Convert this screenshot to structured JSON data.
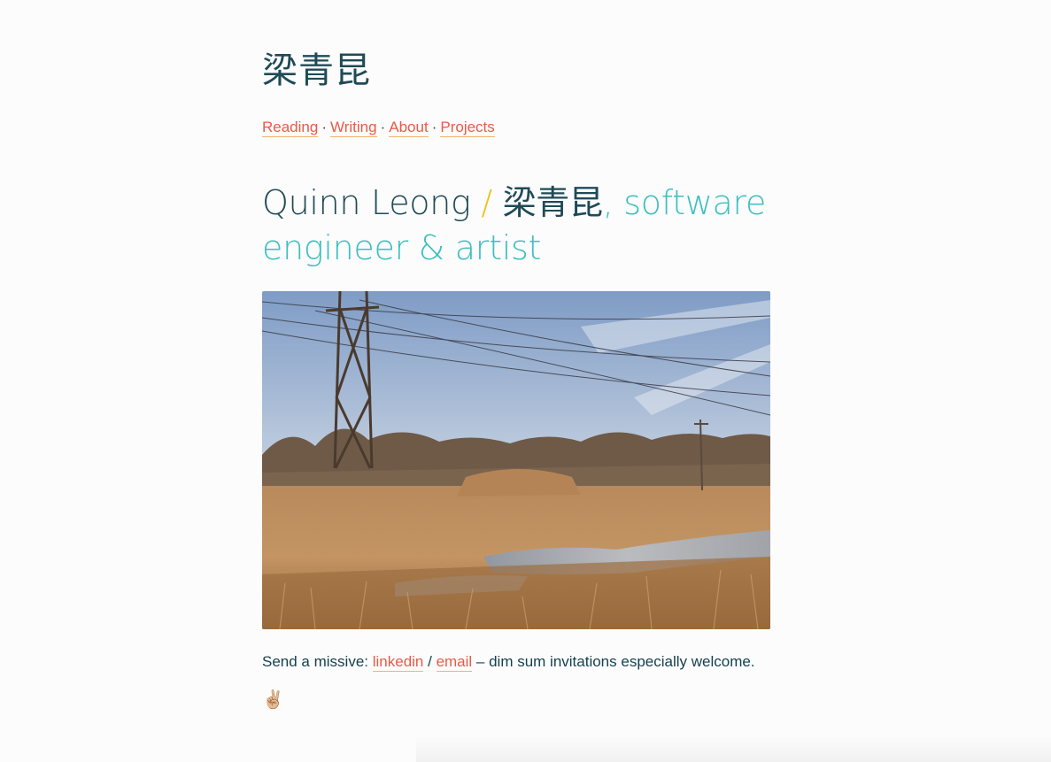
{
  "site": {
    "title": "梁青昆"
  },
  "nav": {
    "items": [
      {
        "label": "Reading"
      },
      {
        "label": "Writing"
      },
      {
        "label": "About"
      },
      {
        "label": "Projects"
      }
    ],
    "separator": "·"
  },
  "hero": {
    "name_en": "Quinn Leong",
    "slash": "/",
    "name_zh": "梁青昆",
    "tagline": ", software engineer & artist"
  },
  "photo": {
    "alt": "Power lines over a dry marsh field"
  },
  "contact": {
    "prefix": "Send a missive: ",
    "linkedin_label": "linkedin",
    "divider": " / ",
    "email_label": "email",
    "suffix": " – dim sum invitations especially welcome."
  },
  "signoff": {
    "emoji": "✌🏼"
  },
  "colors": {
    "link": "#ea5a45",
    "link_underline": "#f5b36b",
    "heading": "#1f4a56",
    "accent_teal": "#3cbfbf",
    "accent_yellow": "#f0c020"
  }
}
